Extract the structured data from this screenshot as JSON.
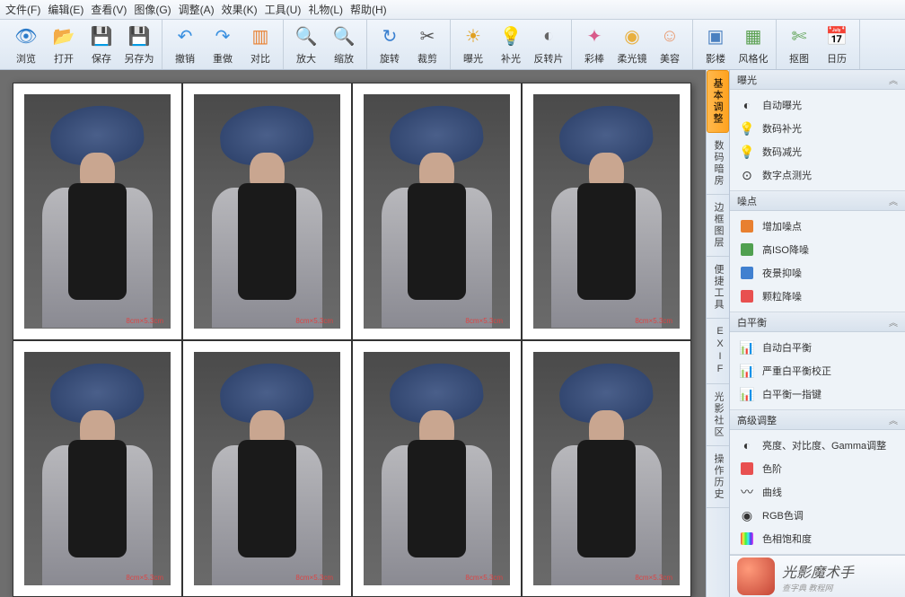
{
  "menu": {
    "file": "文件(F)",
    "edit": "编辑(E)",
    "view": "查看(V)",
    "image": "图像(G)",
    "adjust": "调整(A)",
    "effect": "效果(K)",
    "tool": "工具(U)",
    "gift": "礼物(L)",
    "help": "帮助(H)"
  },
  "toolbar": [
    {
      "id": "browse",
      "label": "浏览",
      "icon": "👁",
      "cls": "i-eye"
    },
    {
      "id": "open",
      "label": "打开",
      "icon": "📂",
      "cls": "i-folder"
    },
    {
      "id": "save",
      "label": "保存",
      "icon": "💾",
      "cls": "i-save"
    },
    {
      "id": "saveas",
      "label": "另存为",
      "icon": "💾",
      "cls": "i-save"
    },
    {
      "id": "undo",
      "label": "撤销",
      "icon": "↶",
      "cls": "i-undo"
    },
    {
      "id": "redo",
      "label": "重做",
      "icon": "↷",
      "cls": "i-undo"
    },
    {
      "id": "compare",
      "label": "对比",
      "icon": "▥",
      "cls": "i-compare"
    },
    {
      "id": "zoomin",
      "label": "放大",
      "icon": "🔍",
      "cls": "i-zoom"
    },
    {
      "id": "zoomout",
      "label": "缩放",
      "icon": "🔍",
      "cls": "i-zoom"
    },
    {
      "id": "rotate",
      "label": "旋转",
      "icon": "↻",
      "cls": "i-rotate"
    },
    {
      "id": "crop",
      "label": "裁剪",
      "icon": "✂",
      "cls": "i-crop"
    },
    {
      "id": "exposure",
      "label": "曝光",
      "icon": "☀",
      "cls": "i-sun"
    },
    {
      "id": "fill",
      "label": "补光",
      "icon": "💡",
      "cls": "i-bulb"
    },
    {
      "id": "invert",
      "label": "反转片",
      "icon": "◐",
      "cls": "i-invert"
    },
    {
      "id": "wand",
      "label": "彩棒",
      "icon": "✦",
      "cls": "i-wand"
    },
    {
      "id": "softlens",
      "label": "柔光镜",
      "icon": "◉",
      "cls": "i-soft"
    },
    {
      "id": "beauty",
      "label": "美容",
      "icon": "☺",
      "cls": "i-face"
    },
    {
      "id": "studio",
      "label": "影楼",
      "icon": "▣",
      "cls": "i-studio"
    },
    {
      "id": "stylize",
      "label": "风格化",
      "icon": "▦",
      "cls": "i-style"
    },
    {
      "id": "cutout",
      "label": "抠图",
      "icon": "✄",
      "cls": "i-cut"
    },
    {
      "id": "calendar",
      "label": "日历",
      "icon": "📅",
      "cls": "i-cal"
    }
  ],
  "toolbar_groups": [
    4,
    3,
    2,
    2,
    3,
    3,
    2,
    2
  ],
  "side_tabs": [
    {
      "id": "basic",
      "label": "基本调整",
      "active": true
    },
    {
      "id": "darkroom",
      "label": "数码暗房",
      "active": false
    },
    {
      "id": "border",
      "label": "边框图层",
      "active": false
    },
    {
      "id": "quick",
      "label": "便捷工具",
      "active": false
    },
    {
      "id": "exif",
      "label": "EXIF",
      "active": false
    },
    {
      "id": "community",
      "label": "光影社区",
      "active": false
    },
    {
      "id": "history",
      "label": "操作历史",
      "active": false
    }
  ],
  "panels": [
    {
      "id": "exposure",
      "title": "曝光",
      "items": [
        {
          "id": "auto-exposure",
          "label": "自动曝光",
          "icon": "◐"
        },
        {
          "id": "digital-fill",
          "label": "数码补光",
          "icon": "💡"
        },
        {
          "id": "digital-reduce",
          "label": "数码减光",
          "icon": "💡"
        },
        {
          "id": "digital-spot",
          "label": "数字点测光",
          "icon": "⊙"
        }
      ]
    },
    {
      "id": "noise",
      "title": "噪点",
      "items": [
        {
          "id": "add-noise",
          "label": "增加噪点",
          "icon": "▦",
          "iccls": "ic-box ic-orange"
        },
        {
          "id": "high-iso",
          "label": "高ISO降噪",
          "icon": "📈",
          "iccls": "ic-box ic-green"
        },
        {
          "id": "night",
          "label": "夜景抑噪",
          "icon": "▦",
          "iccls": "ic-box ic-blue"
        },
        {
          "id": "grain",
          "label": "颗粒降噪",
          "icon": "▦",
          "iccls": "ic-box ic-red"
        }
      ]
    },
    {
      "id": "whitebalance",
      "title": "白平衡",
      "items": [
        {
          "id": "auto-wb",
          "label": "自动白平衡",
          "icon": "📊"
        },
        {
          "id": "severe-wb",
          "label": "严重白平衡校正",
          "icon": "📊"
        },
        {
          "id": "wb-onekey",
          "label": "白平衡一指键",
          "icon": "📊"
        }
      ]
    },
    {
      "id": "advanced",
      "title": "高级调整",
      "items": [
        {
          "id": "brightness",
          "label": "亮度、对比度、Gamma调整",
          "icon": "◐"
        },
        {
          "id": "levels",
          "label": "色阶",
          "icon": "▦",
          "iccls": "ic-box ic-red"
        },
        {
          "id": "curves",
          "label": "曲线",
          "icon": "〰"
        },
        {
          "id": "rgb-tone",
          "label": "RGB色调",
          "icon": "◉"
        },
        {
          "id": "hue-sat",
          "label": "色相饱和度",
          "icon": "▦",
          "iccls": "ic-box ic-grad"
        }
      ]
    }
  ],
  "branding": {
    "title": "光影魔术手",
    "subtitle": "查字典   教程网"
  },
  "canvas": {
    "grid_cols": 4,
    "grid_rows": 2,
    "photo_count": 8,
    "photo_mark": "8cm×5.3cm"
  }
}
